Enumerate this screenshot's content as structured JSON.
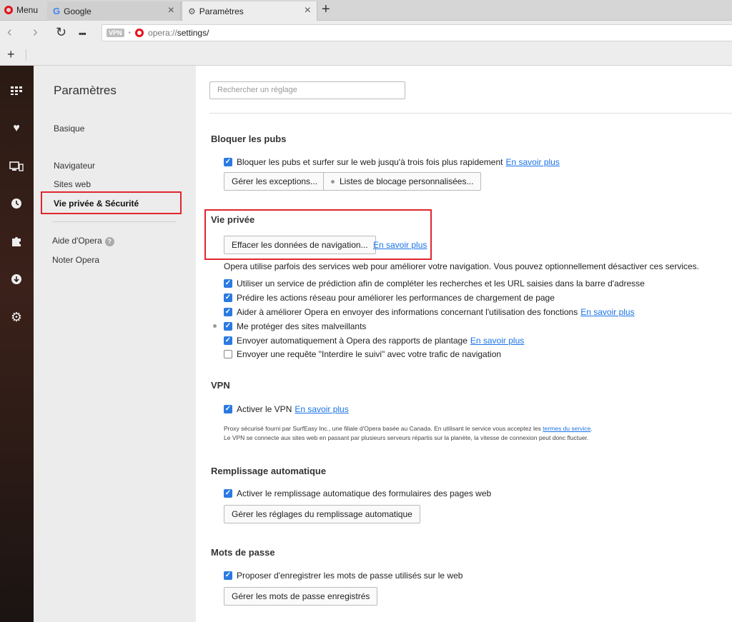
{
  "tabs": {
    "menu_label": "Menu",
    "google_label": "Google",
    "settings_label": "Paramètres"
  },
  "address": {
    "vpn_badge": "VPN",
    "url_scheme": "opera://",
    "url_path": "settings/"
  },
  "leftnav": {
    "title": "Paramètres",
    "items": [
      "Basique",
      "Navigateur",
      "Sites web",
      "Vie privée & Sécurité"
    ],
    "help": "Aide d'Opera",
    "rate": "Noter Opera"
  },
  "search": {
    "placeholder": "Rechercher un réglage"
  },
  "adblock": {
    "title": "Bloquer les pubs",
    "checkbox": "Bloquer les pubs et surfer sur le web jusqu'à trois fois plus rapidement",
    "link": "En savoir plus",
    "btn_exceptions": "Gérer les exceptions...",
    "btn_lists": "Listes de blocage personnalisées..."
  },
  "privacy": {
    "title": "Vie privée",
    "btn_clear": "Effacer les données de navigation...",
    "link": "En savoir plus",
    "desc": "Opera utilise parfois des services web pour améliorer votre navigation. Vous pouvez optionnellement désactiver ces services.",
    "options": [
      {
        "label": "Utiliser un service de prédiction afin de compléter les recherches et les URL saisies dans la barre d'adresse",
        "checked": true,
        "link": ""
      },
      {
        "label": "Prédire les actions réseau pour améliorer les performances de chargement de page",
        "checked": true,
        "link": ""
      },
      {
        "label": "Aider à améliorer Opera en envoyer des informations concernant l'utilisation des fonctions",
        "checked": true,
        "link": "En savoir plus"
      },
      {
        "label": "Me protéger des sites malveillants",
        "checked": true,
        "link": ""
      },
      {
        "label": "Envoyer automatiquement à Opera des rapports de plantage",
        "checked": true,
        "link": "En savoir plus"
      },
      {
        "label": "Envoyer une requête \"Interdire le suivi\" avec votre trafic de navigation",
        "checked": false,
        "link": ""
      }
    ]
  },
  "vpn": {
    "title": "VPN",
    "checkbox": "Activer le VPN",
    "link": "En savoir plus",
    "note1": "Proxy sécurisé fourni par SurfEasy Inc., une filiale d'Opera basée au Canada. En utilisant le service vous acceptez les",
    "note1_link": "termes du service",
    "note1_end": ".",
    "note2": "Le VPN se connecte aux sites web en passant par plusieurs serveurs répartis sur la planète, la vitesse de connexion peut donc fluctuer."
  },
  "autofill": {
    "title": "Remplissage automatique",
    "checkbox": "Activer le remplissage automatique des formulaires des pages web",
    "btn": "Gérer les réglages du remplissage automatique"
  },
  "passwords": {
    "title": "Mots de passe",
    "checkbox": "Proposer d'enregistrer les mots de passe utilisés sur le web",
    "btn": "Gérer les mots de passe enregistrés"
  },
  "colors": {
    "accent": "#2a7ae2",
    "highlight": "#e0262e",
    "opera_red": "#e2141d"
  }
}
